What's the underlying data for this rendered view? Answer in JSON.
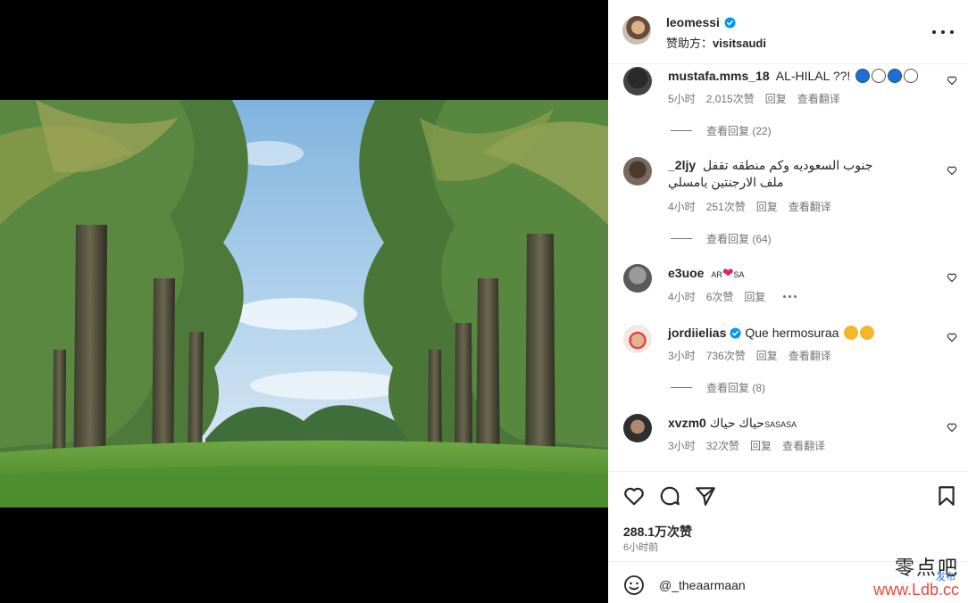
{
  "post": {
    "username": "leomessi",
    "sponsor_prefix": "赞助方：",
    "sponsor_name": "visitsaudi"
  },
  "comments": [
    {
      "username": "mustafa.mms_18",
      "text": "AL-HILAL ??!",
      "time": "5小时",
      "likes": "2,015次赞",
      "reply": "回复",
      "translate": "查看翻译",
      "view_replies": "查看回复 (22)"
    },
    {
      "username": "_2ljy",
      "text": "جنوب السعوديه وكم منطقه تقفل ملف الارجنتين يامسلي",
      "time": "4小时",
      "likes": "251次赞",
      "reply": "回复",
      "translate": "查看翻译",
      "view_replies": "查看回复 (64)"
    },
    {
      "username": "e3uoe",
      "tag_left": "AR",
      "tag_right": "SA",
      "time": "4小时",
      "likes": "6次赞",
      "reply": "回复"
    },
    {
      "username": "jordiielias",
      "text": "Que hermosuraa",
      "time": "3小时",
      "likes": "736次赞",
      "reply": "回复",
      "translate": "查看翻译",
      "view_replies": "查看回复 (8)"
    },
    {
      "username": "xvzm0",
      "text": "حياك حياك",
      "tag": "SASASA",
      "time": "3小时",
      "likes": "32次赞",
      "reply": "回复",
      "translate": "查看翻译"
    }
  ],
  "stats": {
    "likes": "288.1万次赞",
    "time": "6小时前"
  },
  "composer": {
    "value": "@_theaarmaan"
  },
  "watermark": {
    "top": "零点吧",
    "bottom": "www.Ldb.cc",
    "tag": "发布"
  },
  "colors": {
    "verified": "#0095f6",
    "meta": "#737373",
    "heart": "#e0245e"
  }
}
